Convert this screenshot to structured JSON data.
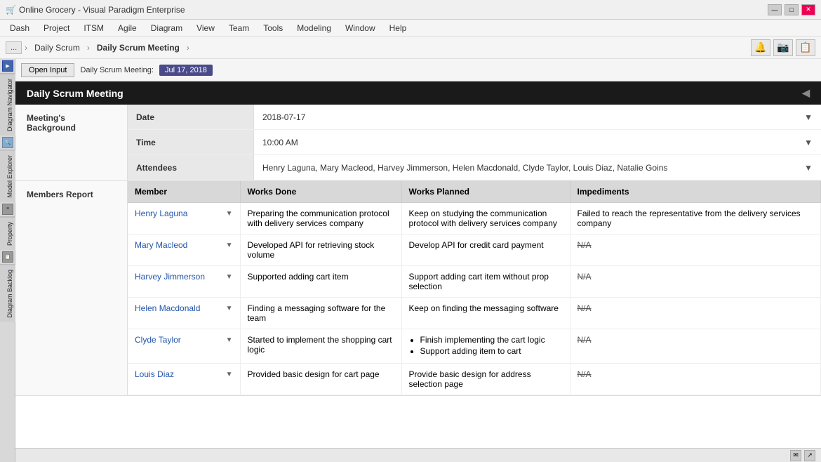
{
  "app": {
    "title": "Online Grocery - Visual Paradigm Enterprise",
    "icon": "🛒"
  },
  "title_controls": {
    "minimize": "—",
    "maximize": "□",
    "close": "✕"
  },
  "menu": {
    "items": [
      "Dash",
      "Project",
      "ITSM",
      "Agile",
      "Diagram",
      "View",
      "Team",
      "Tools",
      "Modeling",
      "Window",
      "Help"
    ]
  },
  "breadcrumb": {
    "ellipsis": "...",
    "items": [
      "Daily Scrum",
      "Daily Scrum Meeting"
    ]
  },
  "toolbar": {
    "open_input": "Open Input",
    "date_label": "Daily Scrum Meeting:",
    "date_value": "Jul 17, 2018"
  },
  "side_nav": {
    "tabs": [
      "Diagram Navigator",
      "Model Explorer",
      "Property",
      "Diagram Backlog"
    ]
  },
  "meeting": {
    "title": "Daily Scrum Meeting",
    "background_label": "Meeting's Background",
    "fields": [
      {
        "name": "Date",
        "value": "2018-07-17"
      },
      {
        "name": "Time",
        "value": "10:00 AM"
      },
      {
        "name": "Attendees",
        "value": "Henry Laguna, Mary Macleod, Harvey Jimmerson, Helen Macdonald, Clyde Taylor, Louis Diaz, Natalie Goins"
      }
    ]
  },
  "members_report": {
    "label": "Members Report",
    "columns": [
      "Member",
      "Works Done",
      "Works Planned",
      "Impediments"
    ],
    "rows": [
      {
        "member": "Henry Laguna",
        "works_done": "Preparing the communication protocol with delivery services company",
        "works_planned": "Keep on studying the communication protocol with delivery services company",
        "impediments": "Failed to reach the representative from the delivery services company"
      },
      {
        "member": "Mary Macleod",
        "works_done": "Developed API for retrieving stock volume",
        "works_planned": "Develop API for credit card payment",
        "impediments": "N/A"
      },
      {
        "member": "Harvey Jimmerson",
        "works_done": "Supported adding cart item",
        "works_planned": "Support adding cart item without prop selection",
        "impediments": "N/A"
      },
      {
        "member": "Helen Macdonald",
        "works_done": "Finding a messaging software for the team",
        "works_planned": "Keep on finding the messaging software",
        "impediments": "N/A"
      },
      {
        "member": "Clyde Taylor",
        "works_done": "Started to implement the shopping cart logic",
        "works_planned_list": [
          "Finish implementing the cart logic",
          "Support adding item to cart"
        ],
        "impediments": "N/A"
      },
      {
        "member": "Louis Diaz",
        "works_done": "Provided basic design for cart page",
        "works_planned": "Provide basic design for address selection page",
        "impediments": "N/A"
      }
    ]
  },
  "status_bar": {
    "email_icon": "✉",
    "export_icon": "↗"
  }
}
